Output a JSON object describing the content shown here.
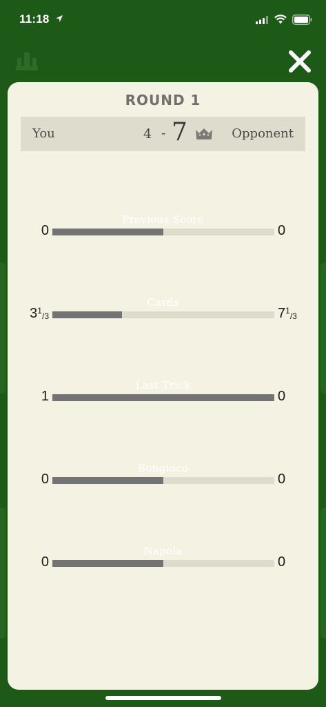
{
  "status_bar": {
    "time": "11:18"
  },
  "round_title": "ROUND 1",
  "scoreboard": {
    "player_you": "You",
    "player_opponent": "Opponent",
    "score_you": "4",
    "separator": "-",
    "score_opponent": "7",
    "winner": "opponent"
  },
  "rows": [
    {
      "label": "Previous Score",
      "left": "0",
      "right": "0",
      "fill_fraction": 0.5
    },
    {
      "label": "Cards",
      "left_whole": "3",
      "left_num": "1",
      "left_den": "3",
      "right_whole": "7",
      "right_num": "1",
      "right_den": "3",
      "fill_fraction": 0.3125
    },
    {
      "label": "Last Trick",
      "left": "1",
      "right": "0",
      "fill_fraction": 1.0
    },
    {
      "label": "Bongioco",
      "left": "0",
      "right": "0",
      "fill_fraction": 0.5
    },
    {
      "label": "Napola",
      "left": "0",
      "right": "0",
      "fill_fraction": 0.5
    }
  ],
  "icons": {
    "location": "location-arrow-icon",
    "signal": "cellular-signal-icon",
    "wifi": "wifi-icon",
    "battery": "battery-icon",
    "top_crown": "crown-icon",
    "close": "close-icon",
    "winner_crown": "crown-icon"
  },
  "colors": {
    "background": "#1d5a17",
    "card": "#f4f3e3",
    "bar_track": "#dedccd",
    "bar_fill": "#737373"
  }
}
